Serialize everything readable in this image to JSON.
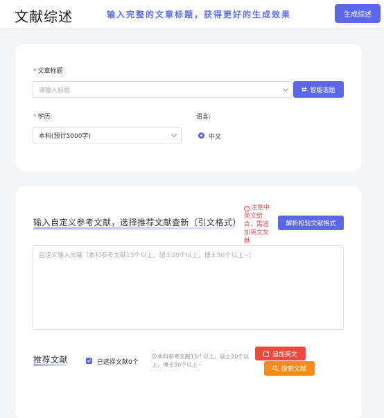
{
  "header": {
    "title": "文献综述",
    "slogan": "输入完整的文章标题，获得更好的生成效果",
    "generate_label": "生成综述"
  },
  "form": {
    "title_label": "文章标题",
    "title_placeholder": "请输入标题",
    "smart_topic_label": "智能选题",
    "degree_label": "学历:",
    "degree_value": "本科(预计5000字)",
    "language_label": "语言:",
    "language_value": "中文"
  },
  "references": {
    "section_title": "输入自定义参考文献，选择推荐文献查新（引文格式）",
    "warning": "注意中英文结合，需追加英文文献",
    "parse_button": "解析校验文献格式",
    "textarea_placeholder": "自定义输入文献（本科参考文献15个以上，硕士20个以上，博士30个以上~）"
  },
  "recommend": {
    "section_title": "推荐文献",
    "selected_label": "已选择文献0个",
    "hint": "本科参考文献15个以上，硕士20个以上，博士30个以上~",
    "add_english_label": "追加英文",
    "search_label": "搜索文献"
  },
  "colors": {
    "accent": "#5b67e6",
    "danger": "#f0493d",
    "warning_orange": "#fb8c1a"
  }
}
